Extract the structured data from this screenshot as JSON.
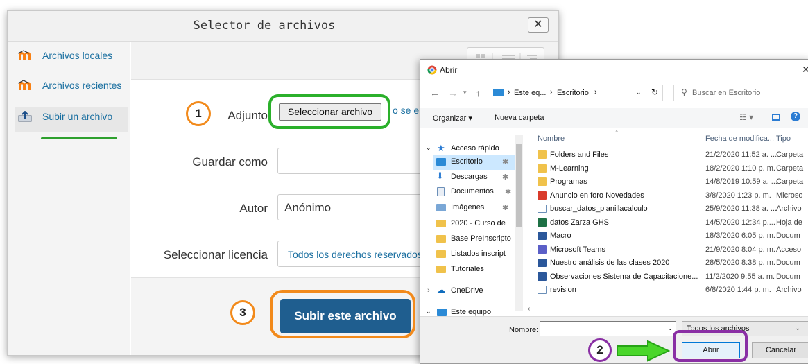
{
  "picker": {
    "title": "Selector de archivos",
    "close": "✕",
    "sidebar": [
      {
        "label": "Archivos locales"
      },
      {
        "label": "Archivos recientes"
      },
      {
        "label": "Subir un archivo"
      }
    ],
    "form": {
      "attachment_label": "Adjunto",
      "select_file_button": "Seleccionar archivo",
      "trailing_text": "o se eli",
      "save_as_label": "Guardar como",
      "save_as_value": "",
      "author_label": "Autor",
      "author_value": "Anónimo",
      "license_label": "Seleccionar licencia",
      "license_value": "Todos los derechos reservados"
    },
    "upload_button": "Subir este archivo"
  },
  "annotations": {
    "step1": "1",
    "step2": "2",
    "step3": "3"
  },
  "dialog": {
    "title": "Abrir",
    "breadcrumb": [
      "Este eq...",
      "Escritorio"
    ],
    "search_placeholder": "Buscar en Escritorio",
    "organize": "Organizar ▾",
    "new_folder": "Nueva carpeta",
    "columns": {
      "name": "Nombre",
      "date": "Fecha de modifica...",
      "type": "Tipo"
    },
    "nav": [
      {
        "label": "Acceso rápido"
      },
      {
        "label": "Escritorio"
      },
      {
        "label": "Descargas"
      },
      {
        "label": "Documentos"
      },
      {
        "label": "Imágenes"
      },
      {
        "label": "2020 - Curso de"
      },
      {
        "label": "Base PreInscripto"
      },
      {
        "label": "Listados inscript"
      },
      {
        "label": "Tutoriales"
      },
      {
        "label": "OneDrive"
      },
      {
        "label": "Este equipo"
      }
    ],
    "files": [
      {
        "name": "Folders and Files",
        "date": "21/2/2020 11:52 a. ...",
        "type": "Carpeta",
        "icon": "folder"
      },
      {
        "name": "M-Learning",
        "date": "18/2/2020 1:10 p. m.",
        "type": "Carpeta",
        "icon": "folder"
      },
      {
        "name": "Programas",
        "date": "14/8/2019 10:59 a. ...",
        "type": "Carpeta",
        "icon": "folder"
      },
      {
        "name": "Anuncio en foro Novedades",
        "date": "3/8/2020 1:23 p. m.",
        "type": "Microso",
        "icon": "pdf"
      },
      {
        "name": "buscar_datos_planillacalculo",
        "date": "25/9/2020 11:38 a. ...",
        "type": "Archivo",
        "icon": "file"
      },
      {
        "name": "datos Zarza GHS",
        "date": "14/5/2020 12:34 p....",
        "type": "Hoja de",
        "icon": "excel"
      },
      {
        "name": "Macro",
        "date": "18/3/2020 6:05 p. m.",
        "type": "Docum",
        "icon": "word"
      },
      {
        "name": "Microsoft Teams",
        "date": "21/9/2020 8:04 p. m.",
        "type": "Acceso",
        "icon": "teams"
      },
      {
        "name": "Nuestro análisis de las clases 2020",
        "date": "28/5/2020 8:38 p. m.",
        "type": "Docum",
        "icon": "word"
      },
      {
        "name": "Observaciones Sistema de Capacitacione...",
        "date": "11/2/2020 9:55 a. m.",
        "type": "Docum",
        "icon": "word"
      },
      {
        "name": "revision",
        "date": "6/8/2020 1:44 p. m.",
        "type": "Archivo",
        "icon": "file"
      }
    ],
    "filename_label": "Nombre:",
    "filename_value": "",
    "filter_value": "Todos los archivos",
    "open_button": "Abrir",
    "cancel_button": "Cancelar"
  },
  "colors": {
    "moodle_link": "#1a6fa0",
    "upload_button": "#1f5e8f",
    "highlight_green": "#2bb02b",
    "highlight_orange": "#f28a1b",
    "highlight_purple": "#8a2fa4",
    "arrow_green": "#4ad62a"
  }
}
